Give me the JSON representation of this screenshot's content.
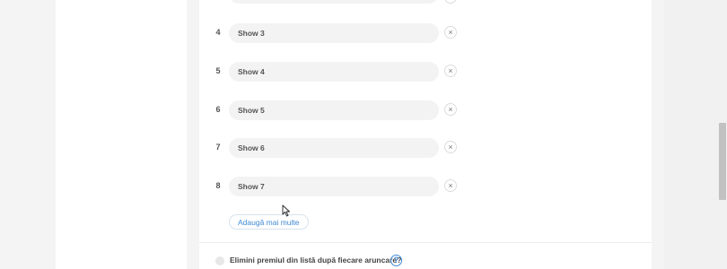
{
  "prize_list": {
    "rows": [
      {
        "number": "4",
        "value": "Show 3",
        "remove": "×"
      },
      {
        "number": "5",
        "value": "Show 4",
        "remove": "×"
      },
      {
        "number": "6",
        "value": "Show 5",
        "remove": "×"
      },
      {
        "number": "7",
        "value": "Show 6",
        "remove": "×"
      },
      {
        "number": "8",
        "value": "Show 7",
        "remove": "×"
      }
    ],
    "add_more_label": "Adaugă mai multe"
  },
  "options": {
    "remove_prize_label": "Elimini premiul din listă după fiecare aruncare?",
    "help_glyph": "?"
  },
  "colors": {
    "accent": "#3f8ad3",
    "field_bg": "#f2f3f2",
    "page_bg": "#f3f4f3"
  }
}
